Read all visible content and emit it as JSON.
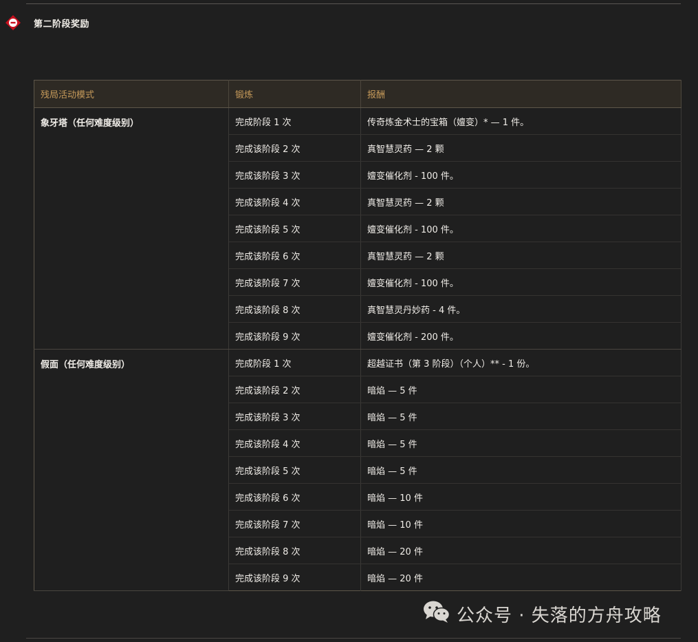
{
  "section": {
    "title": "第二阶段奖励"
  },
  "table": {
    "headers": [
      "残局活动模式",
      "锻炼",
      "报酬"
    ],
    "groups": [
      {
        "mode": "象牙塔（任何难度级别）",
        "rows": [
          {
            "forge": "完成阶段 1 次",
            "reward": "传奇炼金术士的宝箱（嬗变）* — 1 件。"
          },
          {
            "forge": "完成该阶段 2 次",
            "reward": "真智慧灵药 — 2 颗"
          },
          {
            "forge": "完成该阶段 3 次",
            "reward": "嬗变催化剂 - 100 件。"
          },
          {
            "forge": "完成该阶段 4 次",
            "reward": "真智慧灵药 — 2 颗"
          },
          {
            "forge": "完成该阶段 5 次",
            "reward": "嬗变催化剂 - 100 件。"
          },
          {
            "forge": "完成该阶段 6 次",
            "reward": "真智慧灵药 — 2 颗"
          },
          {
            "forge": "完成该阶段 7 次",
            "reward": "嬗变催化剂 - 100 件。"
          },
          {
            "forge": "完成该阶段 8 次",
            "reward": "真智慧灵丹妙药 - 4 件。"
          },
          {
            "forge": "完成该阶段 9 次",
            "reward": "嬗变催化剂 - 200 件。"
          }
        ]
      },
      {
        "mode": "假面（任何难度级别）",
        "rows": [
          {
            "forge": "完成阶段 1 次",
            "reward": "超越证书（第 3 阶段）（个人）** - 1 份。"
          },
          {
            "forge": "完成该阶段 2 次",
            "reward": "暗焰 — 5 件"
          },
          {
            "forge": "完成该阶段 3 次",
            "reward": "暗焰 — 5 件"
          },
          {
            "forge": "完成该阶段 4 次",
            "reward": "暗焰 — 5 件"
          },
          {
            "forge": "完成该阶段 5 次",
            "reward": "暗焰 — 5 件"
          },
          {
            "forge": "完成该阶段 6 次",
            "reward": "暗焰 — 10 件"
          },
          {
            "forge": "完成该阶段 7 次",
            "reward": "暗焰 — 10 件"
          },
          {
            "forge": "完成该阶段 8 次",
            "reward": "暗焰 — 20 件"
          },
          {
            "forge": "完成该阶段 9 次",
            "reward": "暗焰 — 20 件"
          }
        ]
      }
    ]
  },
  "watermark": {
    "text": "公众号 · 失落的方舟攻略",
    "icon": "wechat-icon"
  },
  "colors": {
    "background": "#1f1f1f",
    "header_text": "#c69a5a",
    "header_bg": "#2e2a24",
    "icon_red": "#c8101e"
  }
}
